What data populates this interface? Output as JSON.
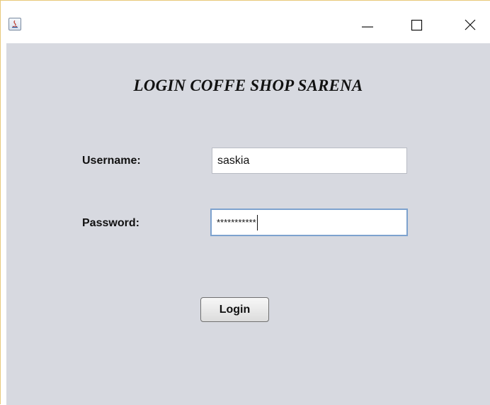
{
  "window": {
    "controls": {
      "minimize_icon": "minimize-icon",
      "maximize_icon": "maximize-icon",
      "close_icon": "close-icon"
    },
    "app_icon": "java-icon"
  },
  "form": {
    "title": "LOGIN COFFE SHOP SARENA",
    "username_label": "Username:",
    "username_value": "saskia",
    "password_label": "Password:",
    "password_value": "***********",
    "login_label": "Login"
  },
  "colors": {
    "background": "#d7d9e0",
    "focus_border": "#7da2ce"
  }
}
